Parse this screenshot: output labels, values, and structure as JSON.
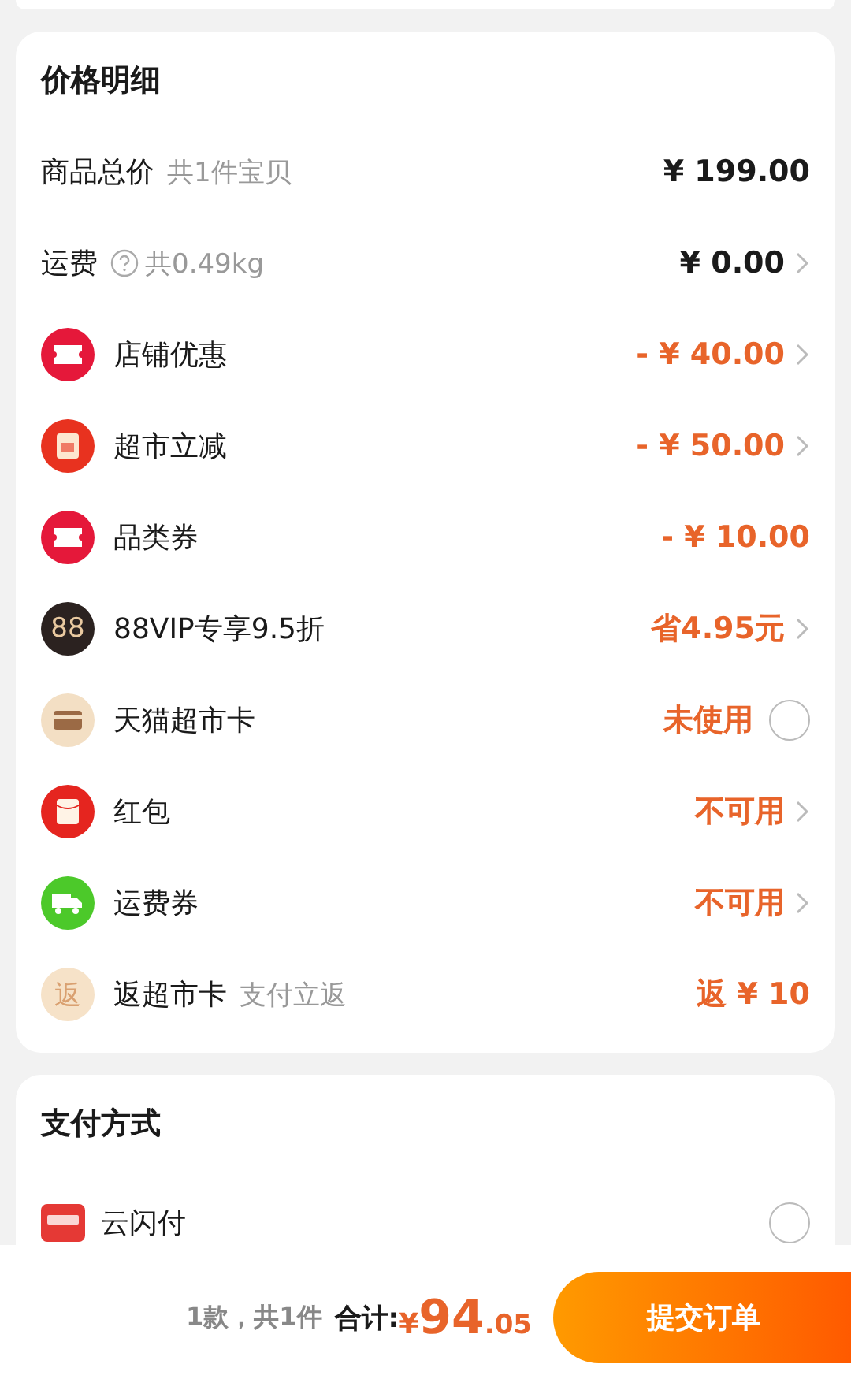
{
  "price_detail": {
    "title": "价格明细",
    "rows": [
      {
        "kind": "plain",
        "label": "商品总价",
        "note": "共1件宝贝",
        "value": "¥ 199.00",
        "highlight": false
      },
      {
        "kind": "plain",
        "label": "运费",
        "help": true,
        "note": "共0.49kg",
        "value": "¥ 0.00",
        "highlight": false,
        "chevron": true
      },
      {
        "kind": "ticket",
        "label": "店铺优惠",
        "value": "- ¥ 40.00",
        "highlight": true,
        "chevron": true
      },
      {
        "kind": "reduce",
        "label": "超市立减",
        "value": "- ¥ 50.00",
        "highlight": true,
        "chevron": true
      },
      {
        "kind": "ticket",
        "label": "品类券",
        "value": "- ¥ 10.00",
        "highlight": true
      },
      {
        "kind": "vip",
        "icon_text": "88",
        "label": "88VIP专享9.5折",
        "value": "省4.95元",
        "highlight": true,
        "chevron": true
      },
      {
        "kind": "card",
        "label": "天猫超市卡",
        "value": "未使用",
        "highlight": true,
        "checked": false
      },
      {
        "kind": "envelope",
        "label": "红包",
        "value": "不可用",
        "highlight": true,
        "chevron": true
      },
      {
        "kind": "truck",
        "label": "运费券",
        "value": "不可用",
        "highlight": true,
        "chevron": true
      },
      {
        "kind": "return",
        "icon_text": "返",
        "label": "返超市卡",
        "note": "支付立返",
        "value": "返 ¥ 10",
        "highlight": true
      }
    ]
  },
  "payment": {
    "title": "支付方式",
    "methods": [
      {
        "label": "云闪付",
        "selected": false
      }
    ]
  },
  "footer": {
    "count": "1款，共1件",
    "total_label": "合计:",
    "currency": "¥",
    "total_int": "94",
    "total_dec": ".05",
    "submit": "提交订单"
  }
}
